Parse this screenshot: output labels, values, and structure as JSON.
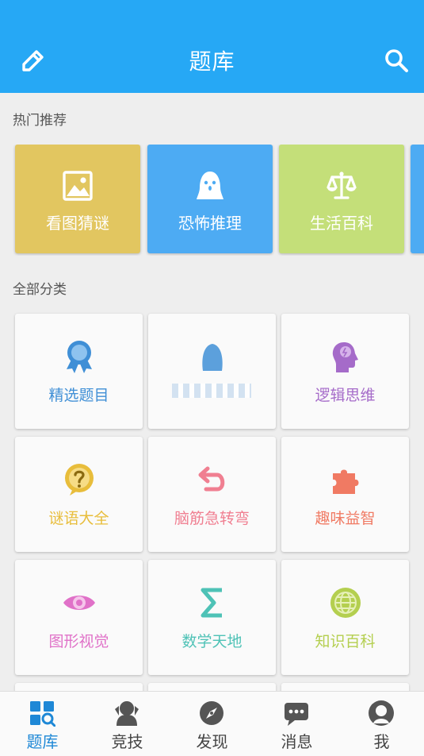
{
  "header": {
    "title": "题库",
    "edit_icon": "pencil-icon",
    "search_icon": "search-icon"
  },
  "hot": {
    "label": "热门推荐",
    "items": [
      {
        "label": "看图猜谜",
        "icon": "image-icon",
        "color": "#e2c660"
      },
      {
        "label": "恐怖推理",
        "icon": "ghost-icon",
        "color": "#4dabf3"
      },
      {
        "label": "生活百科",
        "icon": "scale-icon",
        "color": "#c4df79"
      }
    ]
  },
  "categories": {
    "label": "全部分类",
    "items": [
      {
        "label": "精选题目",
        "icon": "award-icon",
        "color": "#3f8fd6"
      },
      {
        "label": "",
        "icon": "blurred-icon",
        "color": "#3f8fd6"
      },
      {
        "label": "逻辑思维",
        "icon": "brain-head-icon",
        "color": "#a56bc9"
      },
      {
        "label": "谜语大全",
        "icon": "question-bubble-icon",
        "color": "#e8bd3b"
      },
      {
        "label": "脑筋急转弯",
        "icon": "undo-arrow-icon",
        "color": "#f07f91"
      },
      {
        "label": "趣味益智",
        "icon": "puzzle-icon",
        "color": "#f07a63"
      },
      {
        "label": "图形视觉",
        "icon": "eye-icon",
        "color": "#e071c8"
      },
      {
        "label": "数学天地",
        "icon": "sigma-icon",
        "color": "#4ec2b6"
      },
      {
        "label": "知识百科",
        "icon": "globe-icon",
        "color": "#b4cf4f"
      }
    ]
  },
  "tabs": [
    {
      "label": "题库",
      "icon": "tiku-grid-icon",
      "active": true
    },
    {
      "label": "竞技",
      "icon": "competition-person-icon",
      "active": false
    },
    {
      "label": "发现",
      "icon": "compass-icon",
      "active": false
    },
    {
      "label": "消息",
      "icon": "chat-icon",
      "active": false
    },
    {
      "label": "我",
      "icon": "profile-icon",
      "active": false
    }
  ],
  "colors": {
    "primary": "#26a8f5",
    "tab_active": "#1e88d6",
    "tab_inactive": "#555555"
  }
}
